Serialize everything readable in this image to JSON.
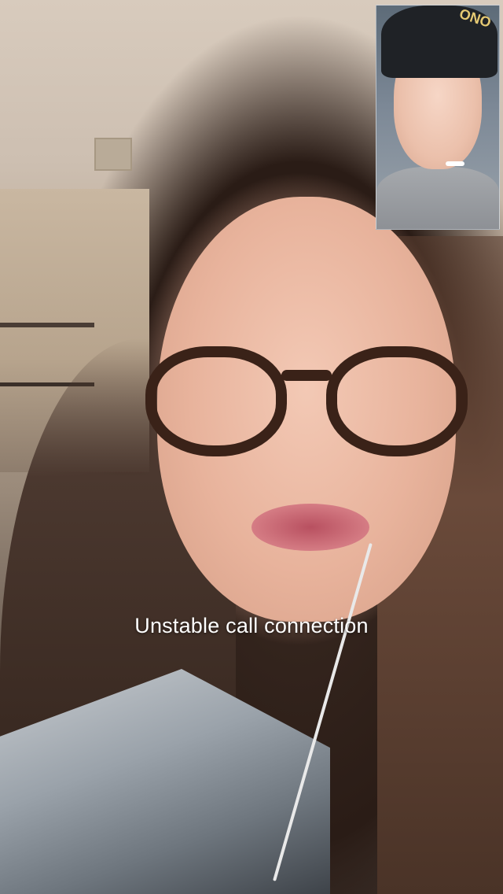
{
  "call": {
    "status_message": "Unstable call connection"
  },
  "self_view": {
    "hat_text": "ONO"
  }
}
